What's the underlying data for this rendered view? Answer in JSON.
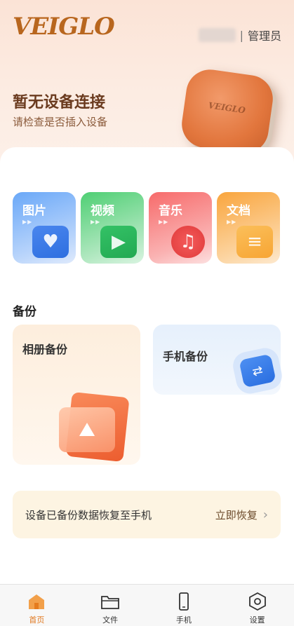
{
  "brand": {
    "logo_text": "VEIGLO"
  },
  "user": {
    "name": "1001",
    "separator": "|",
    "role": "管理员"
  },
  "device_status": {
    "title": "暂无设备连接",
    "subtitle": "请检查是否插入设备",
    "device_mark": "VEIGLO"
  },
  "categories": [
    {
      "label": "图片",
      "icon": "image-icon"
    },
    {
      "label": "视频",
      "icon": "video-icon"
    },
    {
      "label": "音乐",
      "icon": "music-icon"
    },
    {
      "label": "文档",
      "icon": "folder-icon"
    }
  ],
  "backup": {
    "section_title": "备份",
    "album_label": "相册备份",
    "phone_label": "手机备份"
  },
  "restore": {
    "text": "设备已备份数据恢复至手机",
    "action": "立即恢复"
  },
  "tabs": [
    {
      "label": "首页",
      "icon": "home-icon",
      "active": true
    },
    {
      "label": "文件",
      "icon": "folder-icon",
      "active": false
    },
    {
      "label": "手机",
      "icon": "phone-icon",
      "active": false
    },
    {
      "label": "设置",
      "icon": "settings-icon",
      "active": false
    }
  ],
  "colors": {
    "accent": "#e0781f",
    "brand": "#b8661e"
  }
}
